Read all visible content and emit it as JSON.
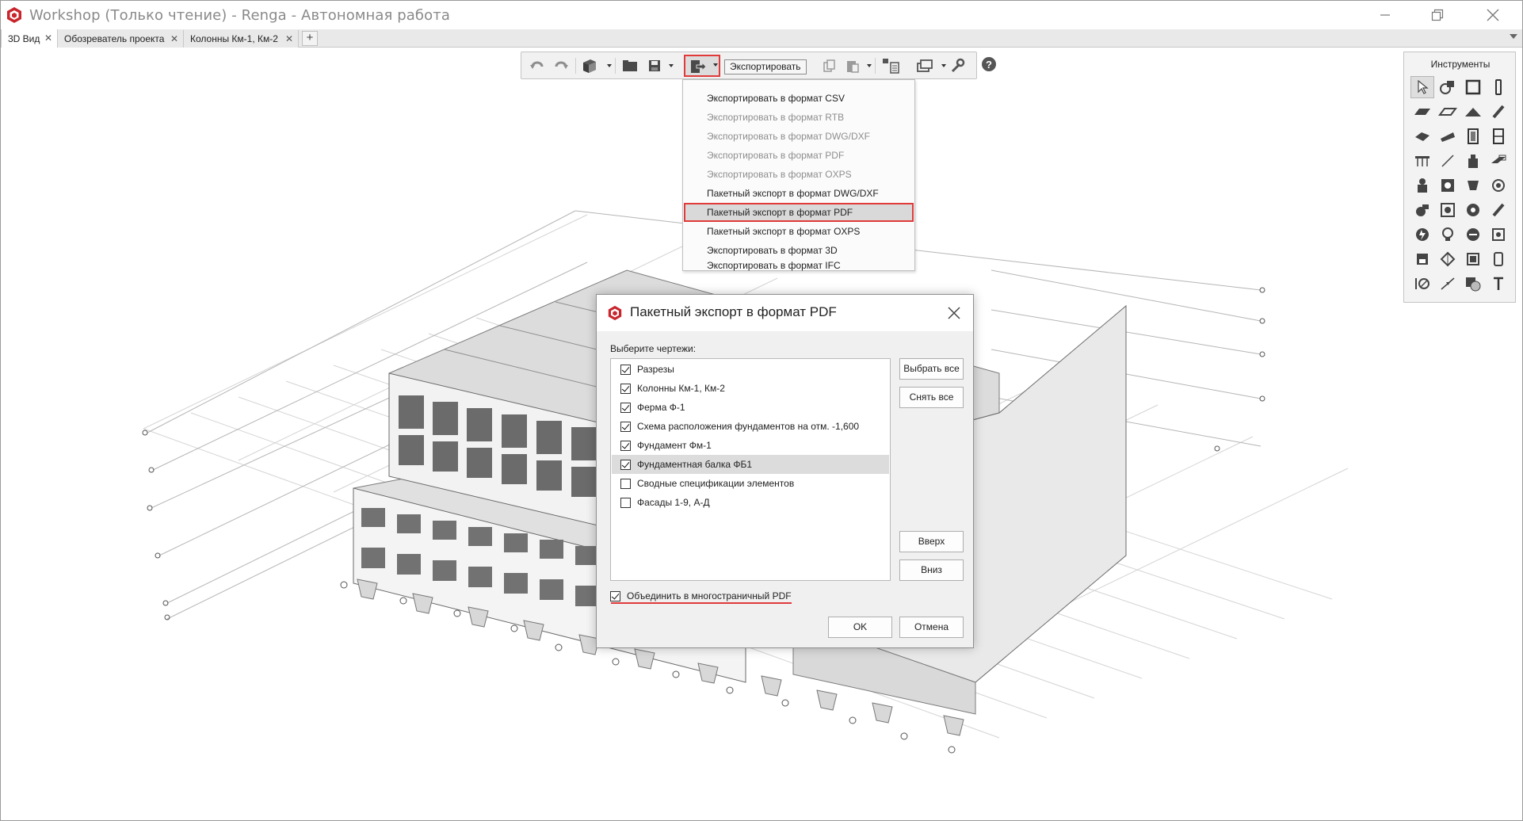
{
  "window": {
    "title": "Workshop (Только чтение) - Renga - Автономная работа",
    "logo_icon": "renga-logo-icon",
    "controls": [
      "minimize-icon",
      "restore-icon",
      "close-icon"
    ]
  },
  "tabs": [
    {
      "label": "3D Вид",
      "active": true
    },
    {
      "label": "Обозреватель проекта",
      "active": false
    },
    {
      "label": "Колонны Км-1, Км-2",
      "active": false
    }
  ],
  "toolbar": {
    "tooltip": "Экспортировать",
    "icons": [
      "undo-icon",
      "redo-icon",
      "view-cube-icon",
      "open-folder-icon",
      "save-icon",
      "export-icon",
      "copy-icon",
      "paste-icon",
      "hierarchy-icon",
      "layers-icon",
      "wrench-icon",
      "help-icon"
    ]
  },
  "export_menu": {
    "items": [
      {
        "label": "Экспортировать в формат CSV",
        "enabled": true
      },
      {
        "label": "Экспортировать в формат RTB",
        "enabled": false
      },
      {
        "label": "Экспортировать в формат DWG/DXF",
        "enabled": false
      },
      {
        "label": "Экспортировать в формат PDF",
        "enabled": false
      },
      {
        "label": "Экспортировать в формат OXPS",
        "enabled": false
      },
      {
        "label": "Пакетный экспорт в формат DWG/DXF",
        "enabled": true
      },
      {
        "label": "Пакетный экспорт в формат PDF",
        "enabled": true,
        "selected": true
      },
      {
        "label": "Пакетный экспорт в формат OXPS",
        "enabled": true
      },
      {
        "label": "Экспортировать в формат 3D",
        "enabled": true
      },
      {
        "label": "Экспортировать в формат IFC",
        "enabled": true
      }
    ]
  },
  "tools_panel": {
    "title": "Инструменты"
  },
  "dialog": {
    "title": "Пакетный экспорт в формат PDF",
    "select_label": "Выберите чертежи:",
    "sheets": [
      {
        "label": "Разрезы",
        "checked": true
      },
      {
        "label": "Колонны Км-1, Км-2",
        "checked": true
      },
      {
        "label": "Ферма Ф-1",
        "checked": true
      },
      {
        "label": "Схема расположения фундаментов на отм. -1,600",
        "checked": true
      },
      {
        "label": "Фундамент Фм-1",
        "checked": true
      },
      {
        "label": "Фундаментная балка ФБ1",
        "checked": true,
        "highlighted": true
      },
      {
        "label": "Сводные спецификации элементов",
        "checked": false
      },
      {
        "label": "Фасады 1-9, А-Д",
        "checked": false
      }
    ],
    "select_all": "Выбрать все",
    "deselect_all": "Снять все",
    "move_up": "Вверх",
    "move_down": "Вниз",
    "merge_label": "Объединить в многостраничный PDF",
    "merge_checked": true,
    "ok": "OK",
    "cancel": "Отмена"
  },
  "colors": {
    "highlight_red": "#e03a3a",
    "logo_red": "#c8252c"
  }
}
